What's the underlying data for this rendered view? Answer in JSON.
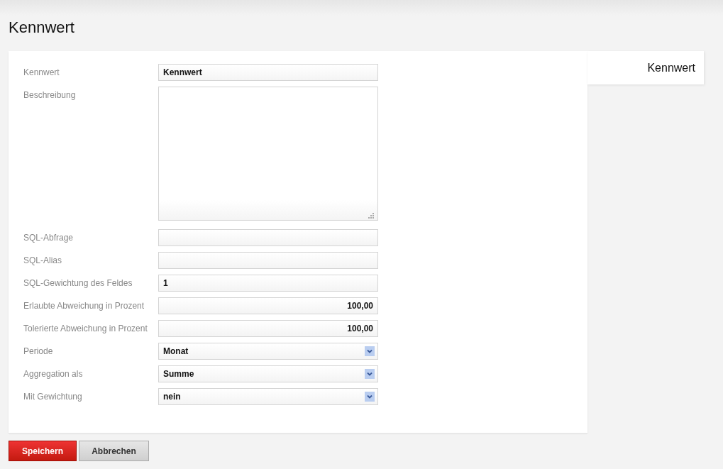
{
  "page": {
    "title": "Kennwert"
  },
  "form": {
    "fields": [
      {
        "kind": "text",
        "label": "Kennwert",
        "value": "Kennwert"
      },
      {
        "kind": "textarea",
        "label": "Beschreibung"
      },
      {
        "kind": "text",
        "label": "SQL-Abfrage"
      },
      {
        "kind": "text",
        "label": "SQL-Alias"
      },
      {
        "kind": "text",
        "label": "SQL-Gewichtung des Feldes",
        "value": "1"
      },
      {
        "kind": "number",
        "label": "Erlaubte Abweichung in Prozent",
        "value": "100,00"
      },
      {
        "kind": "number",
        "label": "Tolerierte Abweichung in Prozent",
        "value": "100,00"
      },
      {
        "kind": "select",
        "label": "Periode",
        "value": "Monat"
      },
      {
        "kind": "select",
        "label": "Aggregation als",
        "value": "Summe"
      },
      {
        "kind": "select",
        "label": "Mit Gewichtung",
        "value": "nein"
      }
    ]
  },
  "side_tabs": [
    {
      "label": "Kennwert",
      "selected": true
    }
  ],
  "buttons": [
    {
      "label": "Speichern",
      "kind": "primary"
    },
    {
      "label": "Abbrechen",
      "kind": "secondary"
    }
  ]
}
